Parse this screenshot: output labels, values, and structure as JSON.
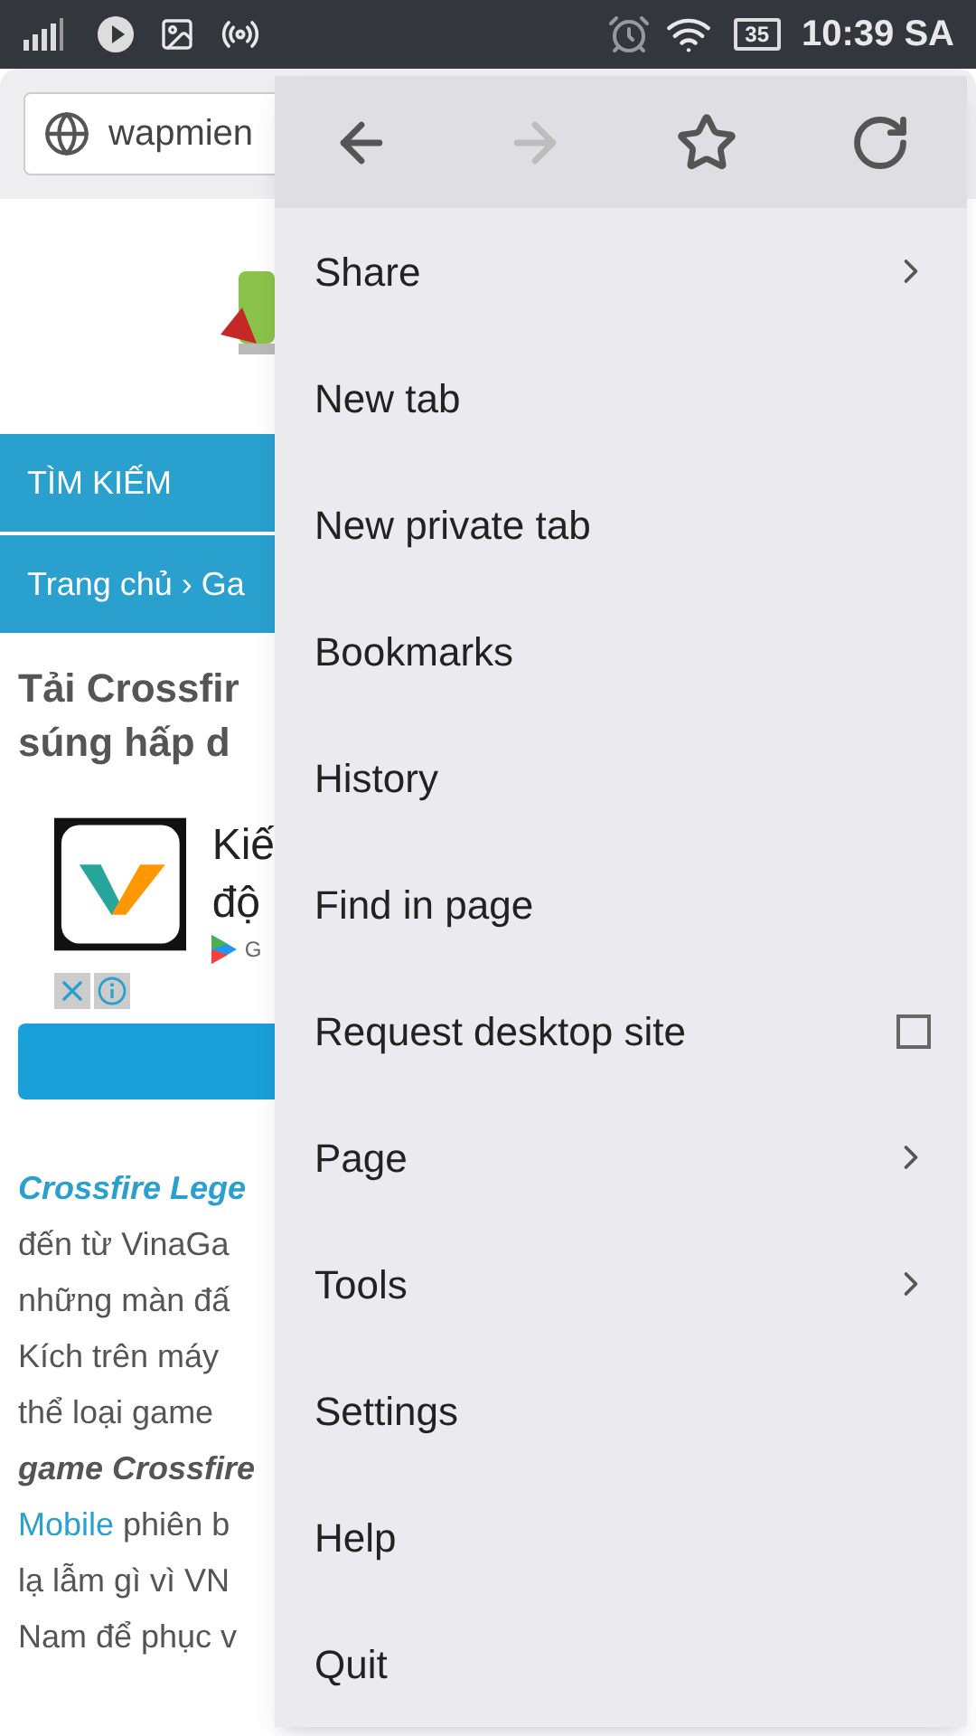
{
  "status_bar": {
    "battery": "35",
    "time": "10:39 SA"
  },
  "address_bar": {
    "url": "wapmien"
  },
  "page": {
    "search_bar": "TÌM KIẾM",
    "breadcrumb": "Trang chủ › Ga",
    "title_lines": [
      "Tải Crossfir",
      "súng hấp d"
    ],
    "ad": {
      "headline_lines": [
        "Kiế",
        "độ"
      ],
      "store": "G"
    },
    "paragraph_lines": [
      {
        "kind": "lead",
        "text": "Crossfire Lege"
      },
      {
        "kind": "plain",
        "text": "đến từ VinaGa"
      },
      {
        "kind": "plain",
        "text": "những màn đấ"
      },
      {
        "kind": "plain",
        "text": "Kích trên máy"
      },
      {
        "kind": "plain",
        "text": "thể loại game"
      },
      {
        "kind": "emphasis",
        "text": "game Crossfire"
      },
      {
        "kind": "link_start",
        "link": "Mobile",
        "text": "phiên b"
      },
      {
        "kind": "plain",
        "text": "lạ lẫm gì vì VN"
      },
      {
        "kind": "plain",
        "text": "Nam để phục v"
      }
    ]
  },
  "menu": {
    "toolbar": [
      {
        "kind": "back",
        "disabled": false
      },
      {
        "kind": "forward",
        "disabled": true
      },
      {
        "kind": "bookmark",
        "disabled": false
      },
      {
        "kind": "reload",
        "disabled": false
      }
    ],
    "items": [
      {
        "kind": "submenu",
        "label": "Share"
      },
      {
        "kind": "plain",
        "label": "New tab"
      },
      {
        "kind": "plain",
        "label": "New private tab"
      },
      {
        "kind": "plain",
        "label": "Bookmarks"
      },
      {
        "kind": "plain",
        "label": "History"
      },
      {
        "kind": "plain",
        "label": "Find in page"
      },
      {
        "kind": "checkbox",
        "label": "Request desktop site",
        "checked": false
      },
      {
        "kind": "submenu",
        "label": "Page"
      },
      {
        "kind": "submenu",
        "label": "Tools"
      },
      {
        "kind": "plain",
        "label": "Settings"
      },
      {
        "kind": "plain",
        "label": "Help"
      },
      {
        "kind": "plain",
        "label": "Quit"
      }
    ]
  }
}
